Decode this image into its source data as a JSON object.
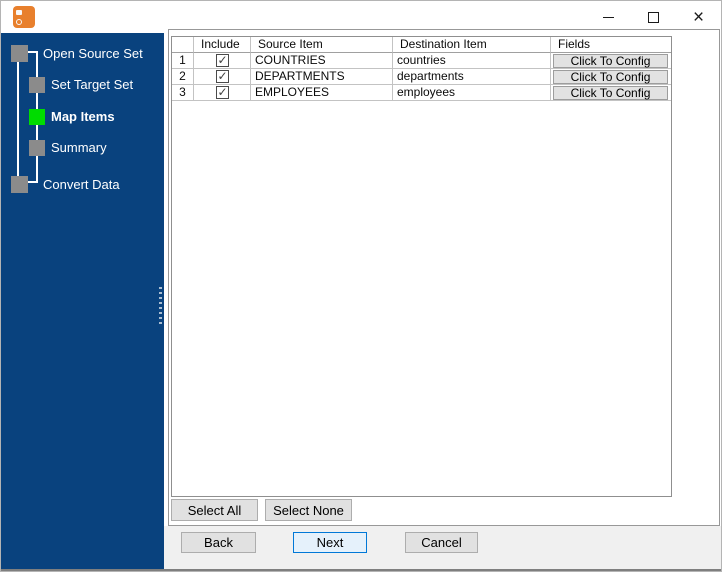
{
  "window": {
    "controls": {
      "minimize_icon": "minimize",
      "maximize_icon": "maximize",
      "close_icon": "close",
      "close_glyph": "×"
    }
  },
  "sidebar": {
    "steps": [
      {
        "label": "Open Source Set",
        "state": "inactive",
        "indent": 0
      },
      {
        "label": "Set Target Set",
        "state": "inactive",
        "indent": 1
      },
      {
        "label": "Map Items",
        "state": "active",
        "indent": 1
      },
      {
        "label": "Summary",
        "state": "inactive",
        "indent": 1
      },
      {
        "label": "Convert Data",
        "state": "inactive",
        "indent": 0
      }
    ],
    "colors": {
      "background": "#09427e",
      "active_step": "#00dc00",
      "inactive_step": "#8b8b8b"
    }
  },
  "table": {
    "columns": {
      "num": "",
      "include": "Include",
      "source": "Source Item",
      "destination": "Destination Item",
      "fields": "Fields"
    },
    "rows": [
      {
        "num": "1",
        "include": true,
        "source": "COUNTRIES",
        "destination": "countries",
        "fields_button": "Click To Config"
      },
      {
        "num": "2",
        "include": true,
        "source": "DEPARTMENTS",
        "destination": "departments",
        "fields_button": "Click To Config"
      },
      {
        "num": "3",
        "include": true,
        "source": "EMPLOYEES",
        "destination": "employees",
        "fields_button": "Click To Config"
      }
    ]
  },
  "buttons": {
    "select_all": "Select All",
    "select_none": "Select None",
    "back": "Back",
    "next": "Next",
    "cancel": "Cancel"
  },
  "colors": {
    "accent_focus": "#0078d7",
    "app_icon": "#e8802d",
    "button_face": "#e1e1e1",
    "footer_background": "#f0f0f0"
  }
}
